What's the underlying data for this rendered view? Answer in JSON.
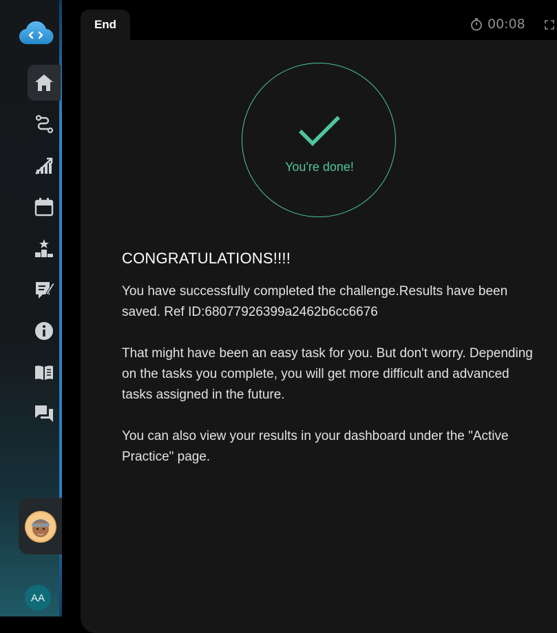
{
  "header": {
    "tab_label": "End",
    "timer": "00:08"
  },
  "result": {
    "status_text": "You're done!",
    "heading": "CONGRATULATIONS!!!!",
    "paragraph_1": "You have successfully completed the challenge.Results have been saved. Ref ID:68077926399a2462b6cc6676",
    "paragraph_2": "That might have been an easy task for you. But don't worry. Depending on the tasks you complete, you will get more difficult and advanced tasks assigned in the future.",
    "paragraph_3": "You can also view your results in your dashboard under the \"Active Practice\" page."
  },
  "sidebar": {
    "items": [
      {
        "icon": "home-icon",
        "active": true
      },
      {
        "icon": "route-icon",
        "active": false
      },
      {
        "icon": "progress-chart-icon",
        "active": false
      },
      {
        "icon": "calendar-icon",
        "active": false
      },
      {
        "icon": "leaderboard-icon",
        "active": false
      },
      {
        "icon": "feedback-icon",
        "active": false
      },
      {
        "icon": "info-icon",
        "active": false
      },
      {
        "icon": "book-icon",
        "active": false
      },
      {
        "icon": "chat-icon",
        "active": false
      }
    ],
    "user_initials": "AA"
  },
  "colors": {
    "accent_success": "#4ec59a",
    "sidebar_edge": "#2f86c8",
    "logo": "#3aa7e8",
    "initials_bg": "#0f6c78"
  }
}
